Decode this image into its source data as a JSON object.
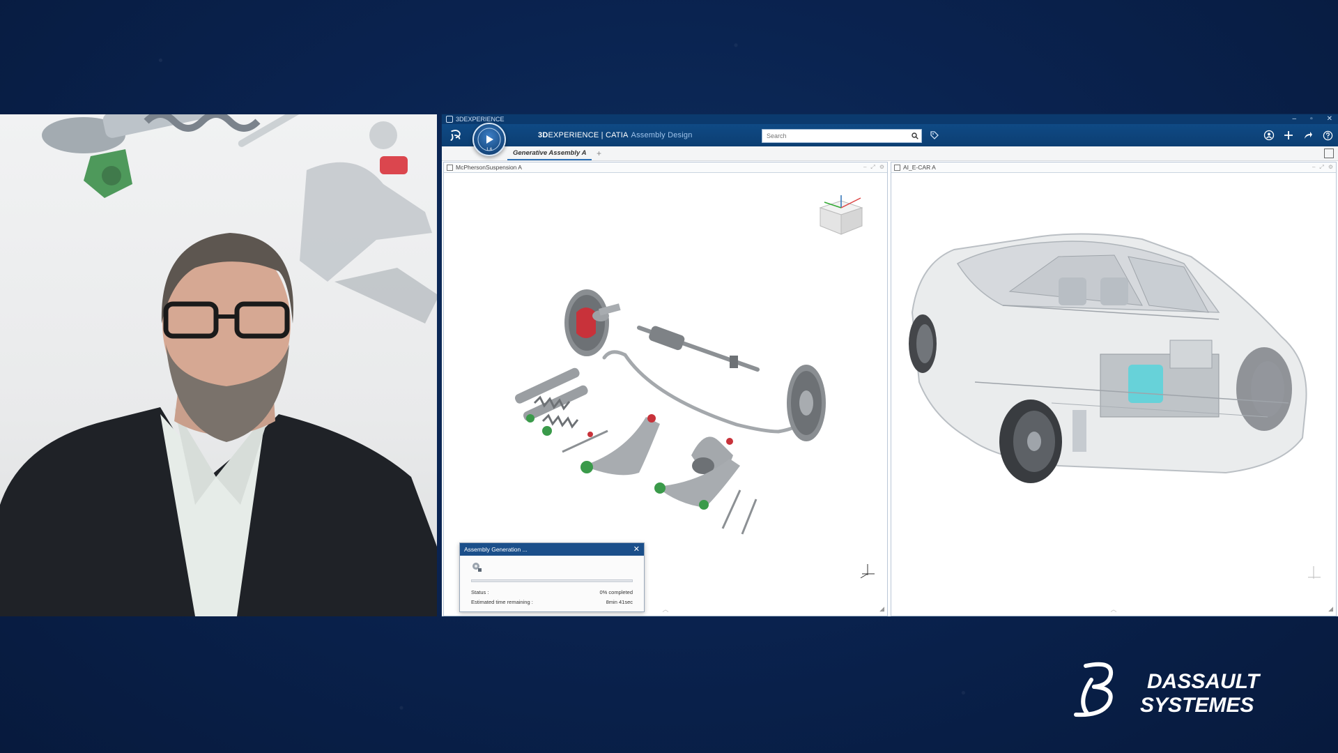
{
  "window": {
    "title": "3DEXPERIENCE",
    "controls": [
      "–",
      "▫",
      "✕"
    ]
  },
  "header": {
    "brand_bold": "3D",
    "brand_rest": "EXPERIENCE | CATIA",
    "app_name": "Assembly Design",
    "compass_label": "1.6",
    "search_placeholder": "Search"
  },
  "tabs": {
    "active_label": "Generative Assembly A",
    "add_label": "+"
  },
  "viewers": {
    "left_title": "McPhersonSuspension A",
    "right_title": "AI_E-CAR A"
  },
  "dialog": {
    "title": "Assembly Generation ...",
    "close": "✕",
    "status_label": "Status :",
    "status_value": "0% completed",
    "eta_label": "Estimated time remaining :",
    "eta_value": "8min 41sec",
    "progress_percent": 0
  },
  "brand_logo": {
    "line1": "DASSAULT",
    "line2": "SYSTEMES"
  },
  "colors": {
    "background": "#0a2350",
    "header": "#0f4a85",
    "accent": "#2b6fb6",
    "brake_red": "#c8323a",
    "bushing_green": "#3a9a4a",
    "motor_cyan": "#5fd0d8"
  }
}
